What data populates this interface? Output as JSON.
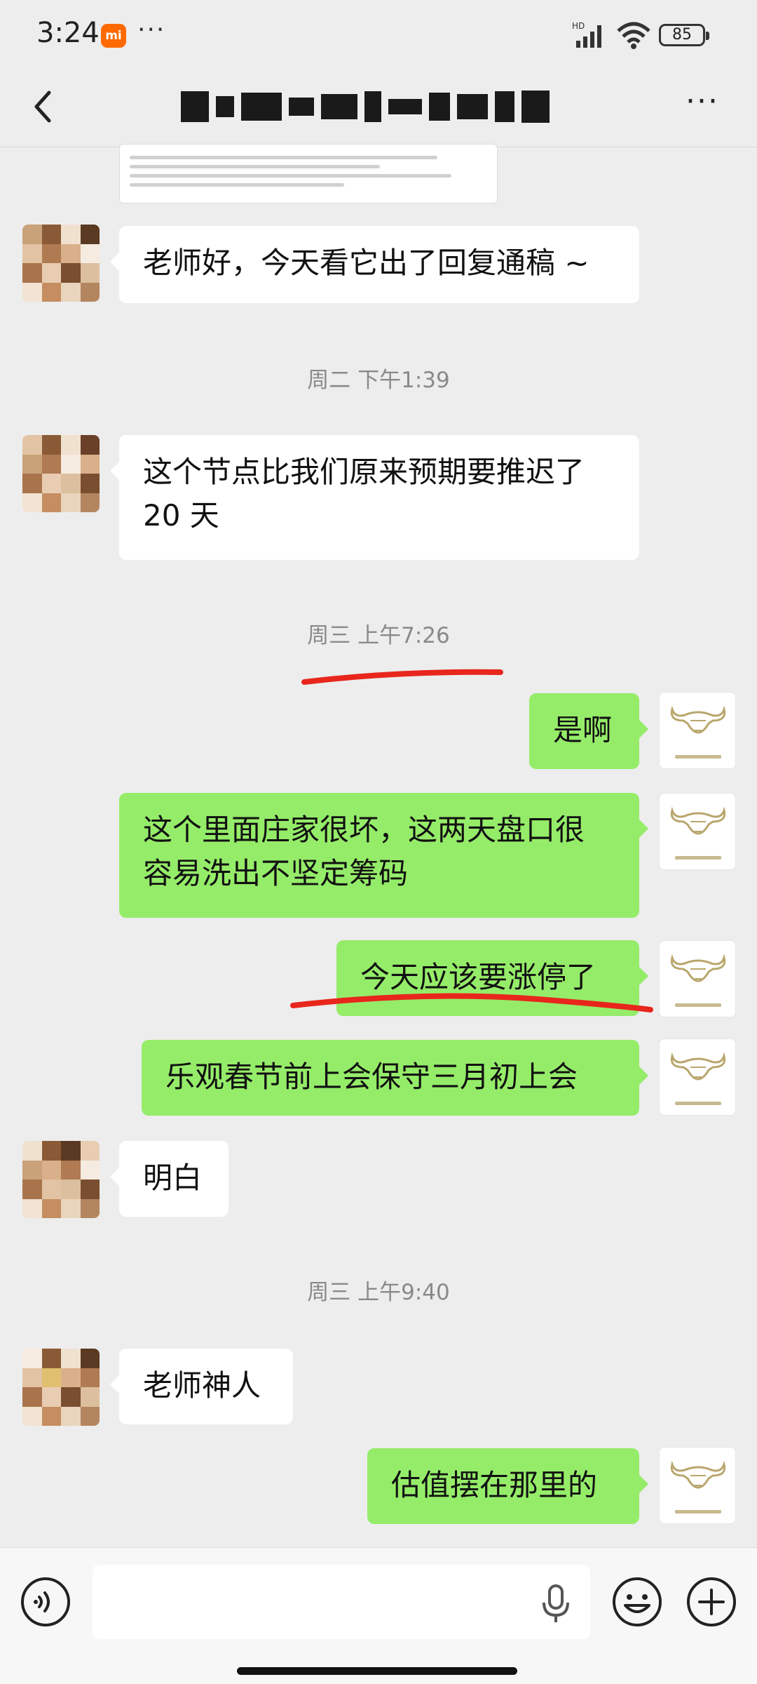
{
  "status_bar": {
    "time": "3:24",
    "brand_badge": "mi",
    "more_dots": "···",
    "network_label": "HD",
    "battery_level": "85"
  },
  "header": {
    "contact_name_redacted": true
  },
  "messages": [
    {
      "side": "left",
      "text": "老师好，今天看它出了回复通稿 ~"
    },
    {
      "type": "time",
      "text": "周二 下午1:39"
    },
    {
      "side": "left",
      "text_line1": "这个节点比我们原来预期要推迟了",
      "text_line2": "20 天"
    },
    {
      "type": "time",
      "text": "周三 上午7:26"
    },
    {
      "side": "right",
      "text": "是啊"
    },
    {
      "side": "right",
      "text_line1": "这个里面庄家很坏，这两天盘口很",
      "text_line2": "容易洗出不坚定筹码"
    },
    {
      "side": "right",
      "text": "今天应该要涨停了"
    },
    {
      "side": "right",
      "text": "乐观春节前上会保守三月初上会"
    },
    {
      "side": "left",
      "text": "明白"
    },
    {
      "type": "time",
      "text": "周三 上午9:40"
    },
    {
      "side": "left",
      "text": "老师神人"
    },
    {
      "side": "right",
      "text": "估值摆在那里的"
    }
  ],
  "input": {
    "placeholder": ""
  },
  "colors": {
    "background": "#ededed",
    "bubble_self": "#95ec69",
    "bubble_other": "#ffffff",
    "annotation_red": "#e8261c"
  },
  "icons": [
    "back-icon",
    "more-icon",
    "voice-icon",
    "mic-icon",
    "emoji-icon",
    "plus-icon",
    "bull-logo-icon"
  ]
}
